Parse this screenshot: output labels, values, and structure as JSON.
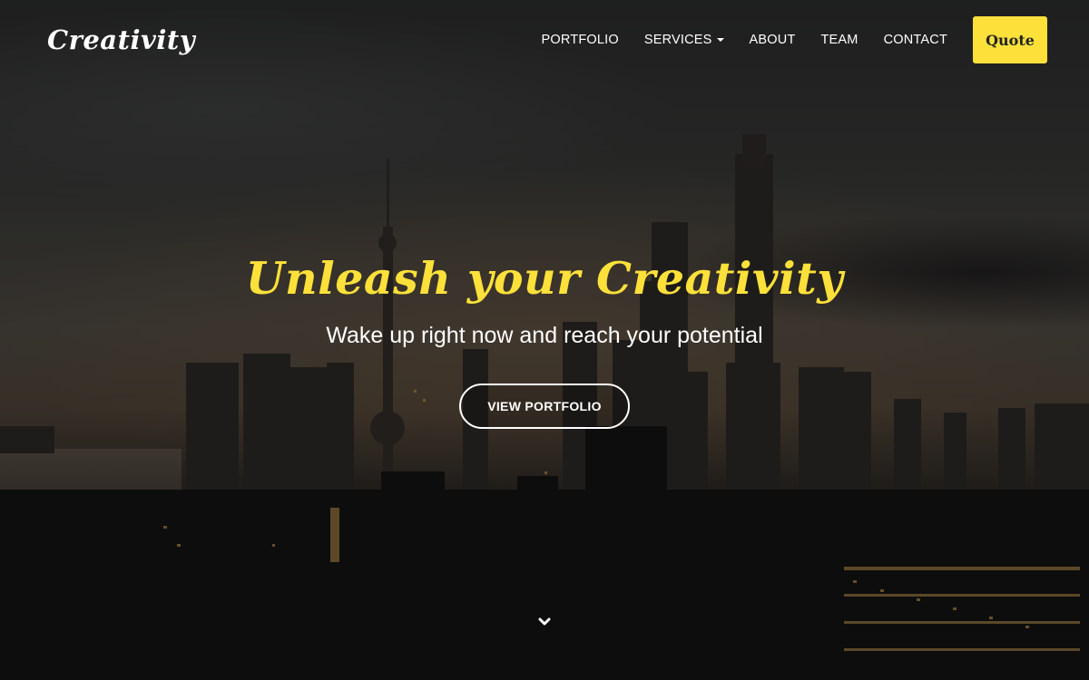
{
  "navbar": {
    "brand": "Creativity",
    "links": [
      {
        "label": "PORTFOLIO"
      },
      {
        "label": "SERVICES",
        "has_dropdown": true
      },
      {
        "label": "ABOUT"
      },
      {
        "label": "TEAM"
      },
      {
        "label": "CONTACT"
      }
    ],
    "quote_button": "Quote"
  },
  "hero": {
    "headline": "Unleash your Creativity",
    "tagline": "Wake up right now and reach your potential",
    "cta_label": "VIEW PORTFOLIO",
    "scroll_icon": "chevron-down-icon"
  },
  "colors": {
    "accent": "#fde13a",
    "text": "#ffffff",
    "sky_dark": "#2a2b2b",
    "city_dark": "#1b1917"
  }
}
